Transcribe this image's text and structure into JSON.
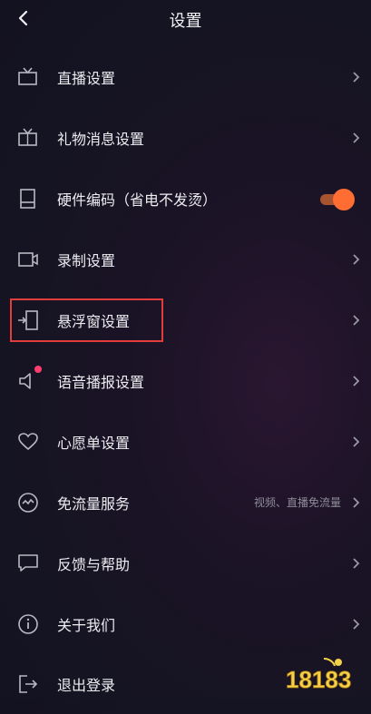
{
  "header": {
    "title": "设置"
  },
  "items": [
    {
      "label": "直播设置",
      "icon": "tv-icon",
      "chevron": true
    },
    {
      "label": "礼物消息设置",
      "icon": "gift-tv-icon",
      "chevron": true
    },
    {
      "label": "硬件编码（省电不发烫）",
      "icon": "hardware-icon",
      "toggle": true,
      "toggle_on": true
    },
    {
      "label": "录制设置",
      "icon": "camera-icon",
      "chevron": true
    },
    {
      "label": "悬浮窗设置",
      "icon": "floating-window-icon",
      "chevron": true,
      "highlighted": true
    },
    {
      "label": "语音播报设置",
      "icon": "speaker-icon",
      "chevron": true,
      "badge_dot": true
    },
    {
      "label": "心愿单设置",
      "icon": "heart-icon",
      "chevron": true
    },
    {
      "label": "免流量服务",
      "icon": "wave-icon",
      "chevron": true,
      "sub": "视频、直播免流量"
    },
    {
      "label": "反馈与帮助",
      "icon": "chat-icon",
      "chevron": true
    },
    {
      "label": "关于我们",
      "icon": "info-icon",
      "chevron": true
    },
    {
      "label": "退出登录",
      "icon": "logout-icon",
      "chevron": false
    }
  ],
  "watermark": {
    "text": "18183"
  },
  "colors": {
    "accent": "#ff6d33",
    "highlight_border": "#e23c3c",
    "badge": "#ff3d6e"
  }
}
